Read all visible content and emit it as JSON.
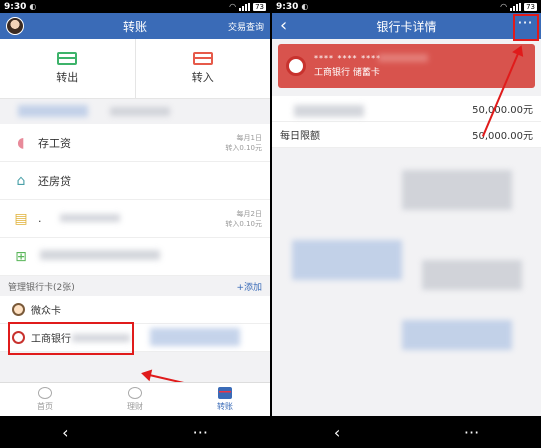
{
  "status": {
    "time": "9:30",
    "battery": "73"
  },
  "left": {
    "title": "转账",
    "nav_right": "交易查询",
    "transfer_out": "转出",
    "transfer_in": "转入",
    "plans": [
      {
        "label": "存工资",
        "date": "每月1日",
        "amount": "转入0.10元"
      },
      {
        "label": "还房贷",
        "date": "",
        "amount": ""
      },
      {
        "label": ".",
        "date": "每月2日",
        "amount": "转入0.10元"
      },
      {
        "label": "",
        "date": "",
        "amount": ""
      }
    ],
    "manage_label": "管理银行卡(2张)",
    "add_label": "+添加",
    "cards": [
      {
        "label": "微众卡"
      },
      {
        "label": "工商银行"
      }
    ],
    "tabs": [
      {
        "label": "首页"
      },
      {
        "label": "理财"
      },
      {
        "label": "转账"
      }
    ],
    "sys_back": "‹",
    "sys_menu": "···"
  },
  "right": {
    "title": "银行卡详情",
    "back": "‹",
    "more": "···",
    "card_number": "**** **** ****",
    "card_name": "工商银行 储蓄卡",
    "single_limit_value": "50,000.00元",
    "daily_limit_label": "每日限额",
    "daily_limit_value": "50,000.00元",
    "sys_back": "‹",
    "sys_menu": "···"
  }
}
